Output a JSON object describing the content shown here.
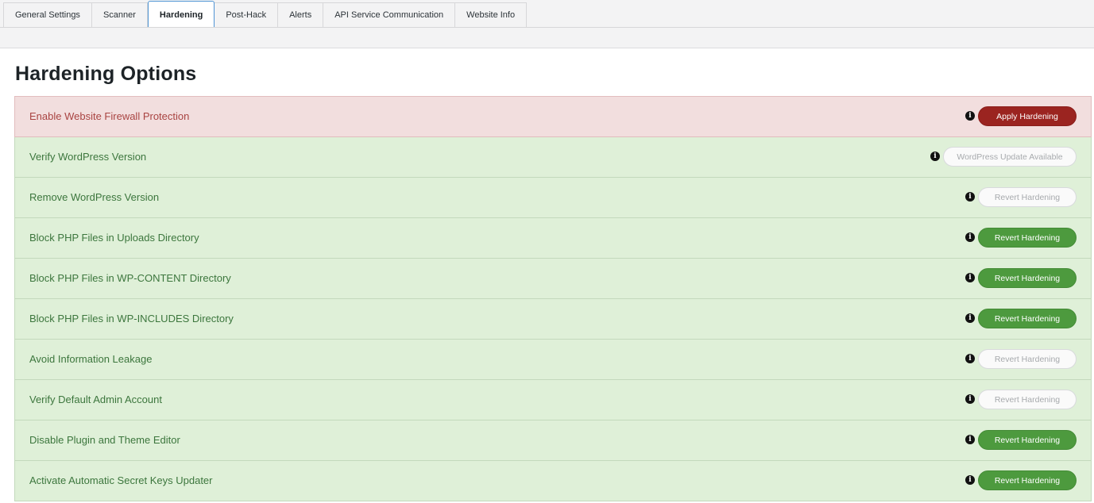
{
  "tabs": [
    {
      "label": "General Settings"
    },
    {
      "label": "Scanner"
    },
    {
      "label": "Hardening"
    },
    {
      "label": "Post-Hack"
    },
    {
      "label": "Alerts"
    },
    {
      "label": "API Service Communication"
    },
    {
      "label": "Website Info"
    }
  ],
  "active_tab": "Hardening",
  "heading": "Hardening Options",
  "info_glyph": "i",
  "colors": {
    "danger_row": "#f2dede",
    "success_row": "#dff0d8",
    "apply_button": "#9b2420",
    "revert_button": "#4d9a3e"
  },
  "options": [
    {
      "label": "Enable Website Firewall Protection",
      "status": "danger",
      "button": "Apply Hardening",
      "button_state": "apply"
    },
    {
      "label": "Verify WordPress Version",
      "status": "success",
      "button": "WordPress Update Available",
      "button_state": "disabled"
    },
    {
      "label": "Remove WordPress Version",
      "status": "success",
      "button": "Revert Hardening",
      "button_state": "disabled"
    },
    {
      "label": "Block PHP Files in Uploads Directory",
      "status": "success",
      "button": "Revert Hardening",
      "button_state": "enabled"
    },
    {
      "label": "Block PHP Files in WP-CONTENT Directory",
      "status": "success",
      "button": "Revert Hardening",
      "button_state": "enabled"
    },
    {
      "label": "Block PHP Files in WP-INCLUDES Directory",
      "status": "success",
      "button": "Revert Hardening",
      "button_state": "enabled"
    },
    {
      "label": "Avoid Information Leakage",
      "status": "success",
      "button": "Revert Hardening",
      "button_state": "disabled"
    },
    {
      "label": "Verify Default Admin Account",
      "status": "success",
      "button": "Revert Hardening",
      "button_state": "disabled"
    },
    {
      "label": "Disable Plugin and Theme Editor",
      "status": "success",
      "button": "Revert Hardening",
      "button_state": "enabled"
    },
    {
      "label": "Activate Automatic Secret Keys Updater",
      "status": "success",
      "button": "Revert Hardening",
      "button_state": "enabled"
    }
  ]
}
